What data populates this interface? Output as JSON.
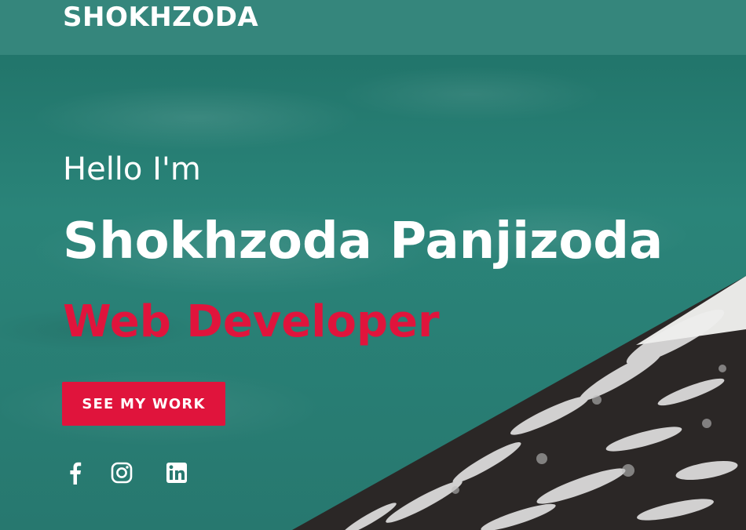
{
  "header": {
    "logo": "SHOKHZODA"
  },
  "hero": {
    "greeting": "Hello I'm",
    "name": "Shokhzoda Panjizoda",
    "role": "Web Developer",
    "cta_label": "SEE MY WORK"
  },
  "socials": [
    {
      "icon": "facebook-icon"
    },
    {
      "icon": "instagram-icon"
    },
    {
      "icon": "linkedin-icon"
    }
  ],
  "colors": {
    "header_bg": "#35867c",
    "hero_teal": "#24766c",
    "accent": "#e0143c",
    "text": "#ffffff",
    "rock": "#2a2727"
  }
}
